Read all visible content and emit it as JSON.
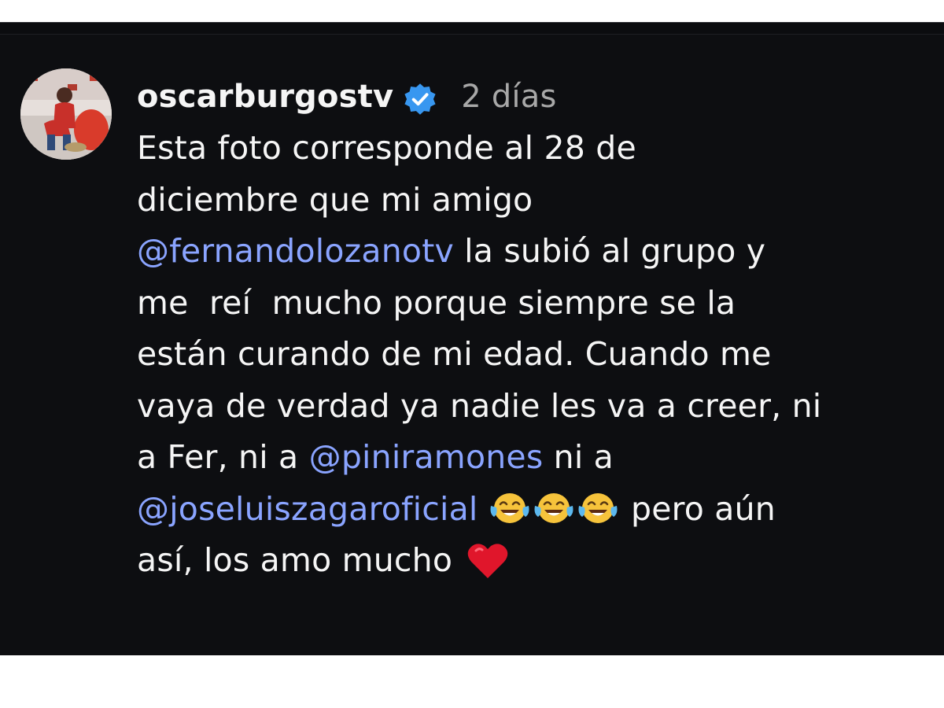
{
  "comment": {
    "username": "oscarburgostv",
    "verified_icon": "verified-badge-icon",
    "time": "2 días",
    "lines": [
      {
        "pre": "Esta foto corresponde al 28 de"
      },
      {
        "pre": "diciembre que mi amigo"
      },
      {
        "mention": "@fernandolozanotv",
        "post": " la subió al grupo y"
      },
      {
        "pre": "me  reí  mucho porque siempre se la"
      },
      {
        "pre": "están curando de mi edad. Cuando me"
      },
      {
        "pre": "vaya de verdad ya nadie les va a creer, ni"
      },
      {
        "pre": "a Fer, ni a ",
        "mention": "@piniramones",
        "post": " ni a"
      },
      {
        "mention": "@joseluiszagaroficial",
        "post": " pero aún",
        "emoji_icon": "laughing-tears-emoji-icon",
        "emoji_count": 3
      },
      {
        "pre": "así, los amo mucho ",
        "heart_icon": "red-heart-icon"
      }
    ]
  },
  "colors": {
    "background": "#0d0e11",
    "text": "#f5f5f5",
    "mention": "#8aa4ff",
    "time": "#a8a8a8",
    "verified": "#3897f0",
    "heart": "#e0162b"
  }
}
